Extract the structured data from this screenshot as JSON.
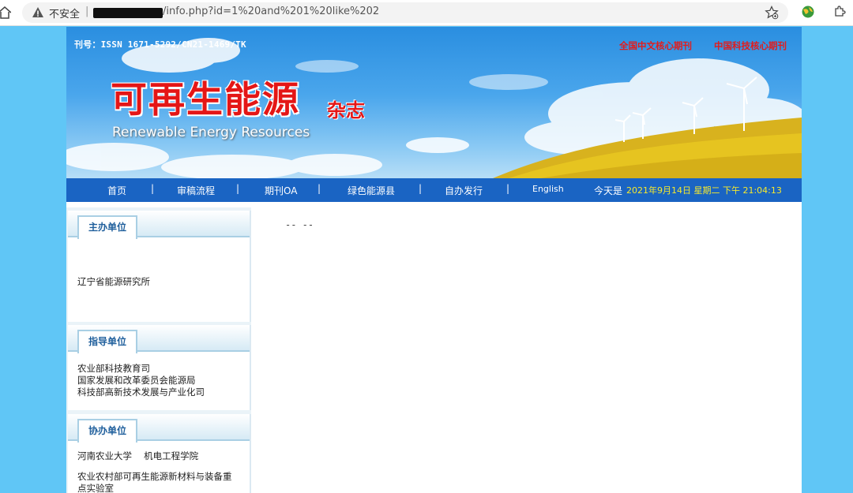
{
  "browser": {
    "insecure_label": "不安全",
    "separator": "|",
    "url_visible": "/info.php?id=1%20and%201%20like%202"
  },
  "banner": {
    "issn": "刊号：ISSN 1671-5292/CN21-1469/TK",
    "core_label_1": "全国中文核心期刊",
    "core_label_2": "中国科技核心期刊",
    "logo_title": "可再生能源",
    "logo_suffix": "杂志",
    "logo_english": "Renewable Energy Resources"
  },
  "nav": {
    "items": [
      "首页",
      "审稿流程",
      "期刊OA",
      "绿色能源县",
      "自办发行",
      "English"
    ],
    "separator": "|",
    "today_label": "今天是",
    "datetime": "2021年9月14日 星期二 下午 21:04:13"
  },
  "sidebar": {
    "boxes": [
      {
        "title": "主办单位",
        "lines": [
          "辽宁省能源研究所"
        ]
      },
      {
        "title": "指导单位",
        "lines": [
          "农业部科技教育司",
          "国家发展和改革委员会能源局",
          "科技部高新技术发展与产业化司"
        ]
      },
      {
        "title": "协办单位",
        "lines": [
          "河南农业大学　 机电工程学院",
          "农业农村部可再生能源新材料与装备重",
          "点实验室"
        ]
      }
    ]
  },
  "content": {
    "text": "-- --"
  },
  "colors": {
    "page_bg": "#60c6f6",
    "nav_bg": "#1a64c3",
    "logo_red": "#e41616",
    "datetime_yellow": "#f6e92c"
  },
  "icons": [
    "home-icon",
    "warning-icon",
    "favorite-star-icon",
    "globe-icon",
    "extensions-icon"
  ]
}
